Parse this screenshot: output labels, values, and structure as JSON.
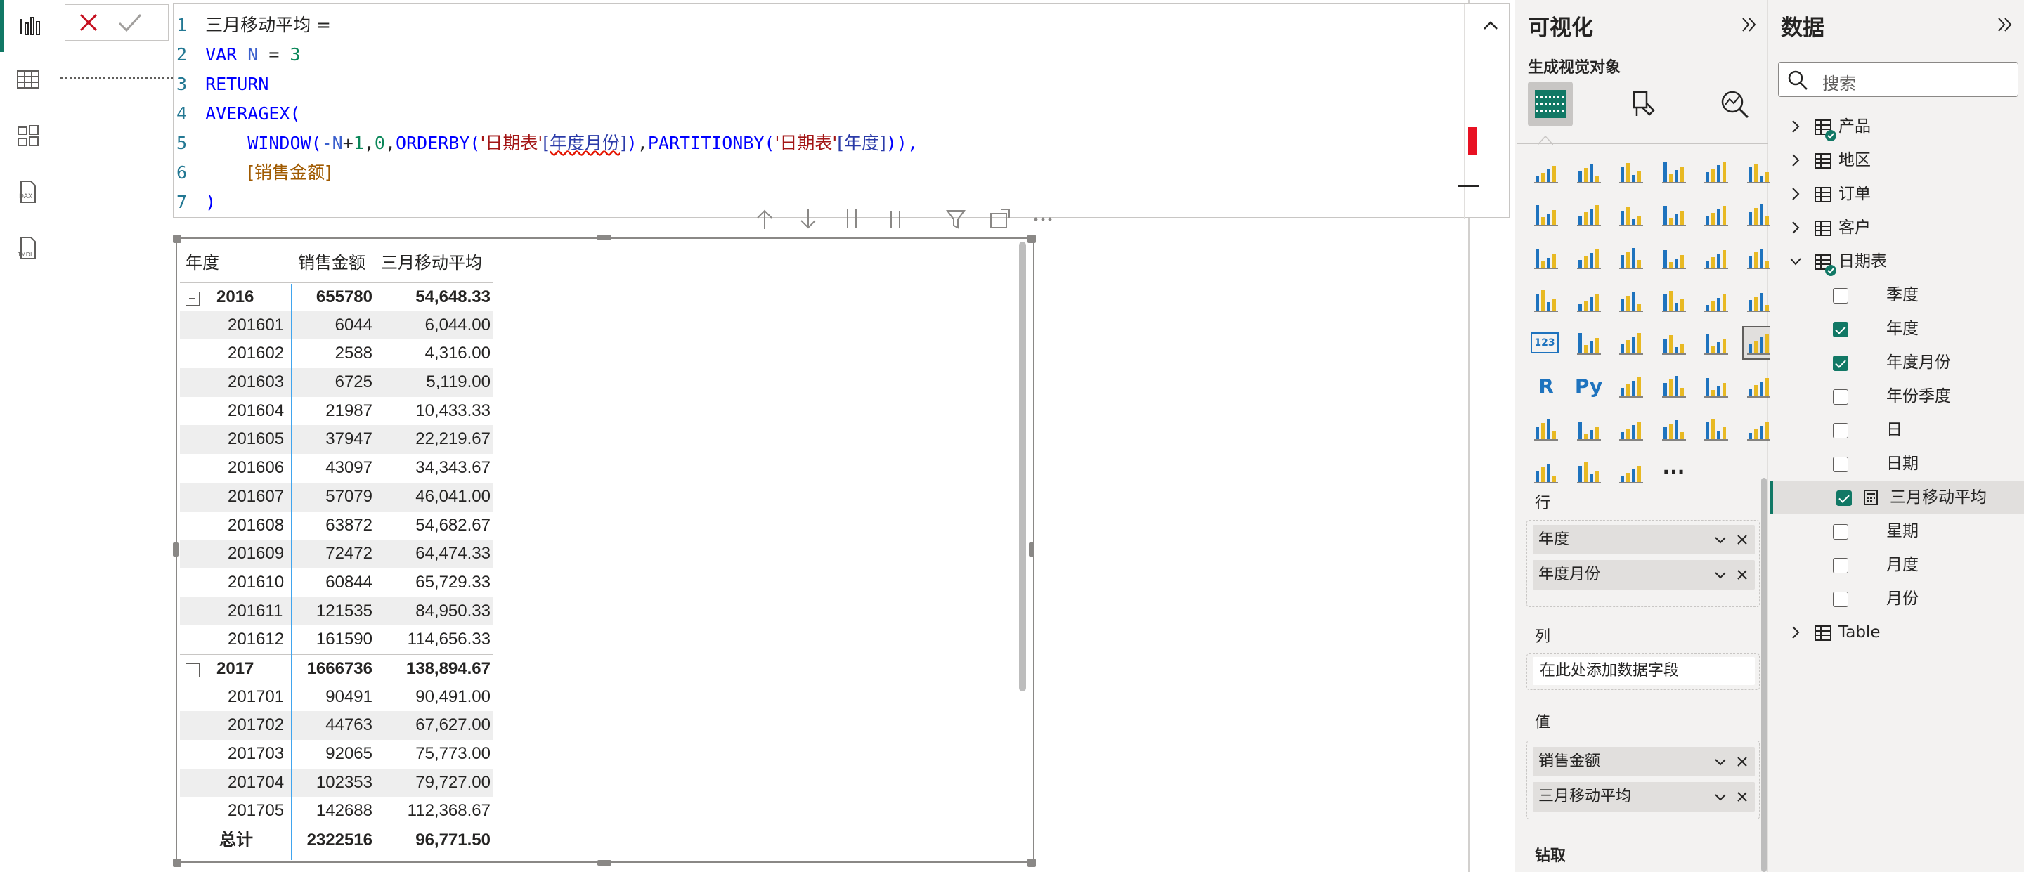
{
  "rail": {
    "items": [
      {
        "name": "report-view-icon",
        "active": true
      },
      {
        "name": "table-view-icon"
      },
      {
        "name": "model-view-icon"
      },
      {
        "name": "dax-query-view-icon",
        "label": "DAX"
      },
      {
        "name": "tmdl-view-icon",
        "label": "TMDL"
      }
    ]
  },
  "formula": {
    "line_numbers": [
      "1",
      "2",
      "3",
      "4",
      "5",
      "6",
      "7"
    ],
    "measure_name": "三月移动平均",
    "eq": " =",
    "var_kw": "VAR",
    "var_name": "N",
    "var_eq": "=",
    "var_val": "3",
    "return_kw": "RETURN",
    "fn_averagex": "AVERAGEX(",
    "window": "WINDOW(",
    "neg_n": "-N",
    "plus": "+",
    "one": "1",
    "comma": ",",
    "zero": "0",
    "orderby": "ORDERBY(",
    "tbl_date": "'日期表'",
    "col_yearmonth": "[年度月份]",
    "close_par": ")",
    "partitionby": "PARTITIONBY(",
    "col_year": "[年度]",
    "end_line5": ")),",
    "measure_ref": "[销售金额]",
    "close_main": ")"
  },
  "table": {
    "headers": [
      "年度",
      "销售金额",
      "三月移动平均"
    ],
    "rows": [
      {
        "type": "year",
        "c1": "2016",
        "c2": "655780",
        "c3": "54,648.33"
      },
      {
        "type": "month",
        "c1": "201601",
        "c2": "6044",
        "c3": "6,044.00"
      },
      {
        "type": "month",
        "c1": "201602",
        "c2": "2588",
        "c3": "4,316.00"
      },
      {
        "type": "month",
        "c1": "201603",
        "c2": "6725",
        "c3": "5,119.00"
      },
      {
        "type": "month",
        "c1": "201604",
        "c2": "21987",
        "c3": "10,433.33"
      },
      {
        "type": "month",
        "c1": "201605",
        "c2": "37947",
        "c3": "22,219.67"
      },
      {
        "type": "month",
        "c1": "201606",
        "c2": "43097",
        "c3": "34,343.67"
      },
      {
        "type": "month",
        "c1": "201607",
        "c2": "57079",
        "c3": "46,041.00"
      },
      {
        "type": "month",
        "c1": "201608",
        "c2": "63872",
        "c3": "54,682.67"
      },
      {
        "type": "month",
        "c1": "201609",
        "c2": "72472",
        "c3": "64,474.33"
      },
      {
        "type": "month",
        "c1": "201610",
        "c2": "60844",
        "c3": "65,729.33"
      },
      {
        "type": "month",
        "c1": "201611",
        "c2": "121535",
        "c3": "84,950.33"
      },
      {
        "type": "month",
        "c1": "201612",
        "c2": "161590",
        "c3": "114,656.33"
      },
      {
        "type": "year",
        "c1": "2017",
        "c2": "1666736",
        "c3": "138,894.67"
      },
      {
        "type": "month",
        "c1": "201701",
        "c2": "90491",
        "c3": "90,491.00"
      },
      {
        "type": "month",
        "c1": "201702",
        "c2": "44763",
        "c3": "67,627.00"
      },
      {
        "type": "month",
        "c1": "201703",
        "c2": "92065",
        "c3": "75,773.00"
      },
      {
        "type": "month",
        "c1": "201704",
        "c2": "102353",
        "c3": "79,727.00"
      },
      {
        "type": "month",
        "c1": "201705",
        "c2": "142688",
        "c3": "112,368.67"
      },
      {
        "type": "total",
        "c1": "总计",
        "c2": "2322516",
        "c3": "96,771.50"
      }
    ]
  },
  "visualizations": {
    "title": "可视化",
    "subtitle": "生成视觉对象",
    "rows_label": "行",
    "rows_fields": [
      "年度",
      "年度月份"
    ],
    "columns_label": "列",
    "columns_placeholder": "在此处添加数据字段",
    "values_label": "值",
    "values_fields": [
      "销售金额",
      "三月移动平均"
    ],
    "drill_label": "钻取",
    "r_label": "R",
    "py_label": "Py",
    "more_label": "···",
    "num_label": "123"
  },
  "data": {
    "title": "数据",
    "search_placeholder": "搜索",
    "tables": [
      {
        "label": "产品",
        "expanded": false
      },
      {
        "label": "地区",
        "expanded": false
      },
      {
        "label": "订单",
        "expanded": false
      },
      {
        "label": "客户",
        "expanded": false
      },
      {
        "label": "日期表",
        "expanded": true
      }
    ],
    "fields": [
      {
        "label": "季度",
        "checked": false
      },
      {
        "label": "年度",
        "checked": true
      },
      {
        "label": "年度月份",
        "checked": true
      },
      {
        "label": "年份季度",
        "checked": false
      },
      {
        "label": "日",
        "checked": false
      },
      {
        "label": "日期",
        "checked": false
      },
      {
        "label": "三月移动平均",
        "checked": true,
        "calc": true
      },
      {
        "label": "星期",
        "checked": false
      },
      {
        "label": "月度",
        "checked": false
      },
      {
        "label": "月份",
        "checked": false
      }
    ],
    "extra_table": "Table"
  },
  "colors": {
    "accent": "#117865",
    "selection": "#41a5ee",
    "error": "#e81123",
    "icon": "#1e73be"
  }
}
